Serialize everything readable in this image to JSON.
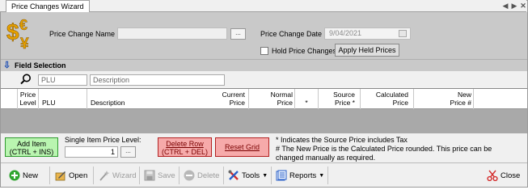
{
  "tab": {
    "title": "Price Changes Wizard"
  },
  "header": {
    "price_change_name_label": "Price Change Name",
    "price_change_name_value": "",
    "browse_label": "...",
    "price_change_date_label": "Price Change Date",
    "price_change_date_value": "9/04/2021",
    "hold_label": "Hold Price Changes",
    "apply_held_label": "Apply Held Prices"
  },
  "field_selection": {
    "title": "Field Selection",
    "plu_placeholder": "PLU",
    "description_placeholder": "Description"
  },
  "grid": {
    "columns": [
      {
        "l1": "Price",
        "l2": "Level"
      },
      {
        "l1": "",
        "l2": "PLU"
      },
      {
        "l1": "",
        "l2": "Description"
      },
      {
        "l1": "Current",
        "l2": "Price"
      },
      {
        "l1": "Normal",
        "l2": "Price"
      },
      {
        "l1": "",
        "l2": "*"
      },
      {
        "l1": "Source",
        "l2": "Price *"
      },
      {
        "l1": "Calculated",
        "l2": "Price"
      },
      {
        "l1": "New",
        "l2": "Price #"
      }
    ]
  },
  "actions": {
    "add_item_l1": "Add Item",
    "add_item_l2": "(CTRL + INS)",
    "single_level_label": "Single Item Price Level:",
    "single_level_value": "1",
    "single_level_browse": "...",
    "delete_row_l1": "Delete Row",
    "delete_row_l2": "(CTRL + DEL)",
    "reset_grid": "Reset Grid",
    "note1": "* Indicates the Source Price includes Tax",
    "note2": "# The New Price is the Calculated Price rounded. This price can be",
    "note3": "changed manually as required.",
    "colors": {
      "add_bg": "#b9f5b0",
      "add_border": "#2f9a2f",
      "delete_bg": "#f6aaaa",
      "delete_border": "#b22222"
    }
  },
  "toolbar": {
    "new": "New",
    "open": "Open",
    "wizard": "Wizard",
    "save": "Save",
    "delete": "Delete",
    "tools": "Tools",
    "reports": "Reports",
    "close": "Close"
  },
  "icons": [
    "dollar-euro-pound-icon",
    "calendar-icon",
    "field-selection-arrow-icon",
    "magnifier-icon",
    "new-icon",
    "open-icon",
    "wizard-icon",
    "save-icon",
    "delete-icon",
    "tools-icon",
    "reports-icon",
    "close-icon"
  ]
}
